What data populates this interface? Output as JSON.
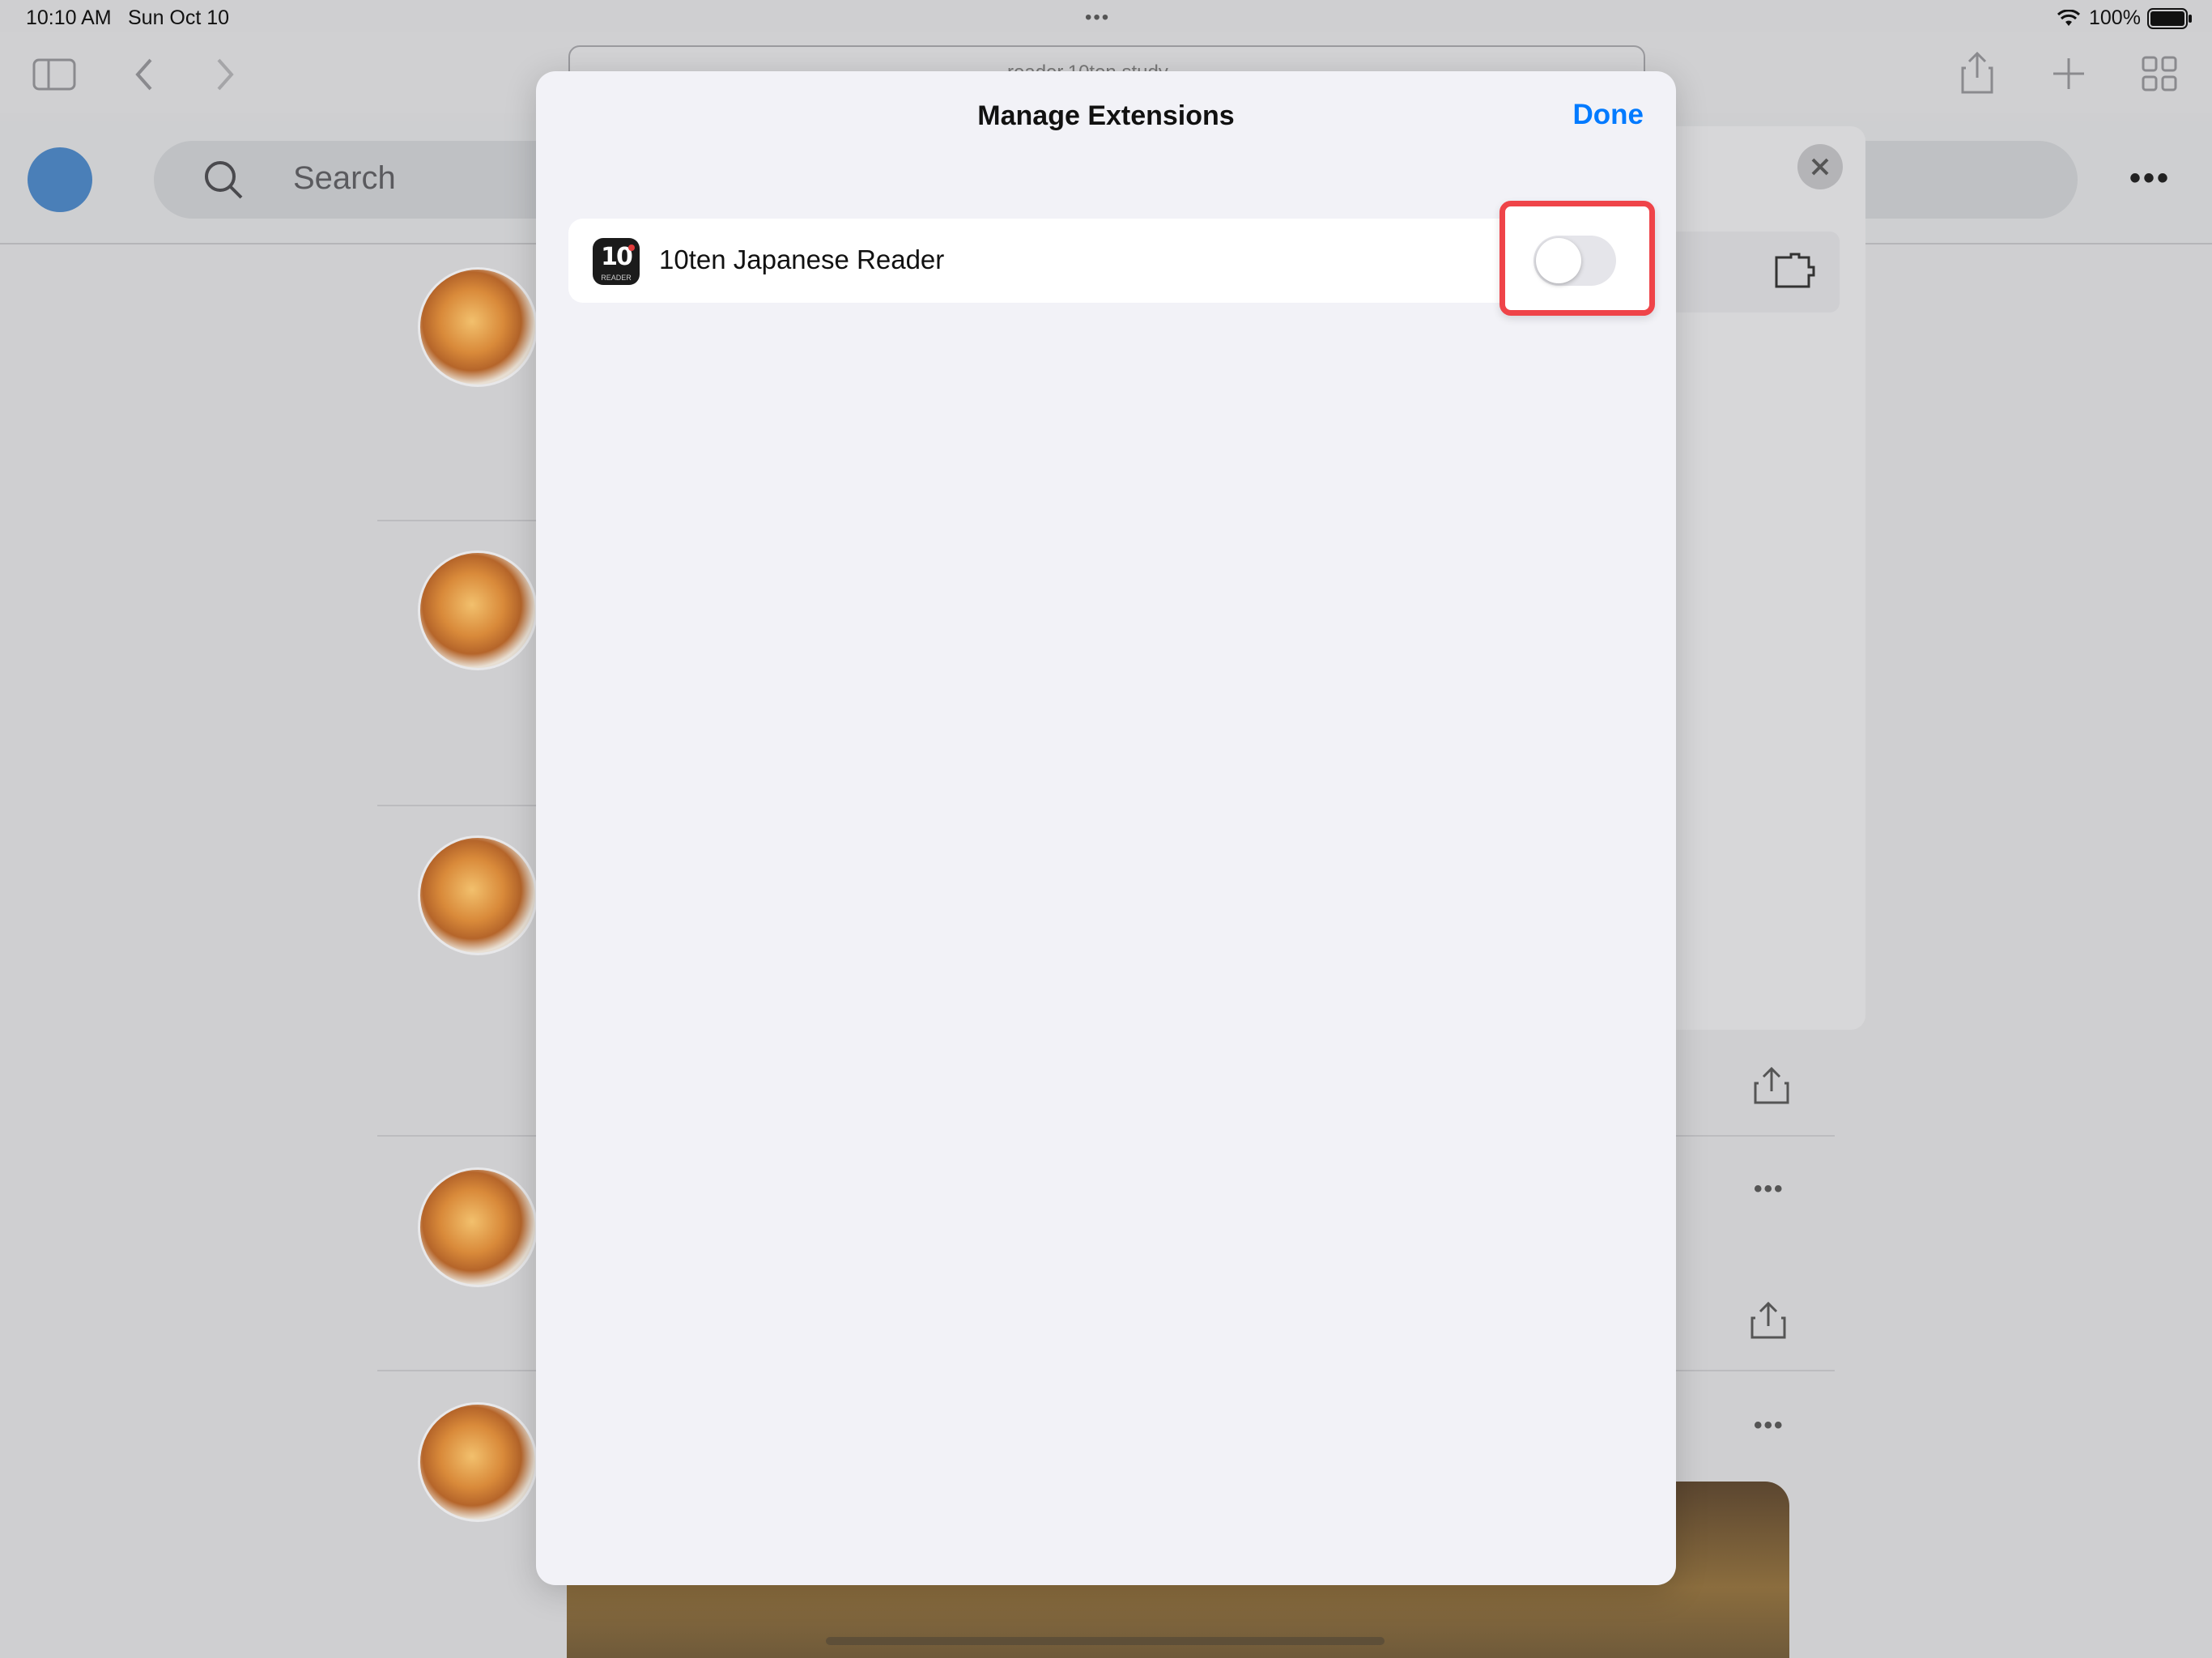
{
  "status_bar": {
    "time": "10:10 AM",
    "date": "Sun Oct 10",
    "battery": "100%"
  },
  "browser": {
    "url_text": "reader.10ten.study"
  },
  "page": {
    "search_placeholder": "Search"
  },
  "modal": {
    "title": "Manage Extensions",
    "done_label": "Done",
    "extensions": [
      {
        "name": "10ten Japanese Reader",
        "enabled": false,
        "icon_text": "10",
        "icon_caption": "READER"
      }
    ]
  },
  "colors": {
    "accent": "#007aff",
    "highlight": "#ef4449",
    "modal_bg": "#f2f2f7"
  }
}
